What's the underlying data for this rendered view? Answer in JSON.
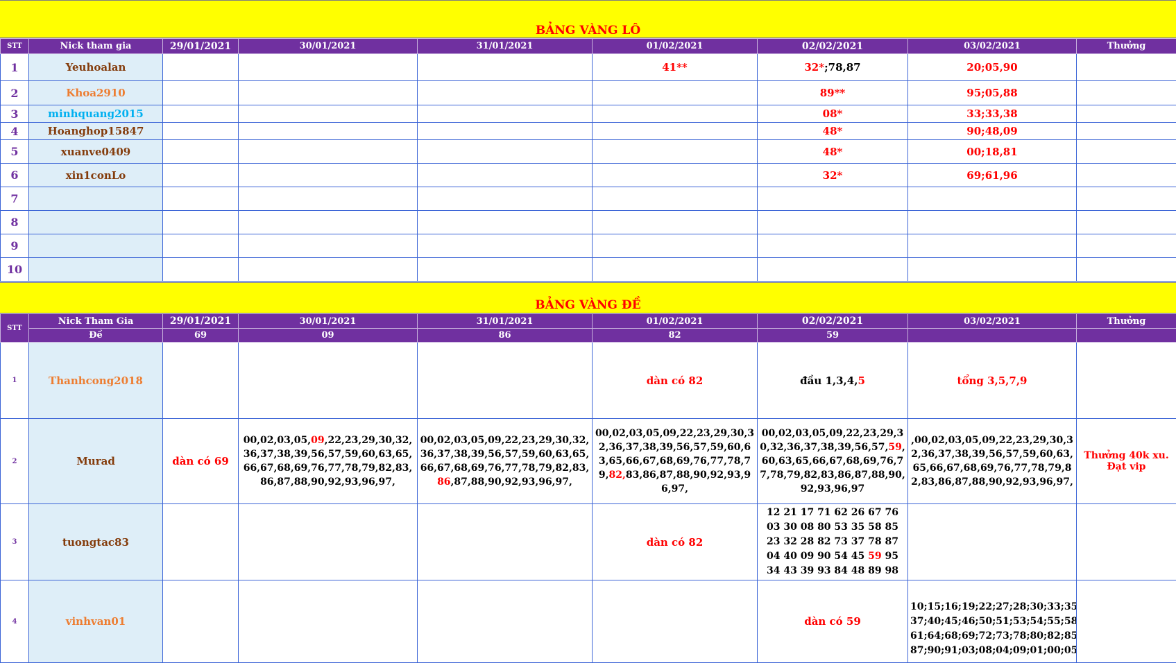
{
  "lo": {
    "title": "BẢNG VÀNG LÔ",
    "headers": {
      "stt": "STT",
      "nick": "Nick tham gia",
      "dates": [
        "29/01/2021",
        "30/01/2021",
        "31/01/2021",
        "01/02/2021",
        "02/02/2021",
        "03/02/2021"
      ],
      "reward": "Thưởng"
    },
    "rows": [
      {
        "stt": "1",
        "nick": "Yeuhoalan",
        "d4": "41**",
        "d5a": "32*",
        "d5b": ";78,87",
        "d6": "20;05,90"
      },
      {
        "stt": "2",
        "nick": "Khoa2910",
        "d5": "89**",
        "d6": "95;05,88"
      },
      {
        "stt": "3",
        "nick": "minhquang2015",
        "d5": "08*",
        "d6": "33;33,38"
      },
      {
        "stt": "4",
        "nick": "Hoanghop15847",
        "d5": "48*",
        "d6": "90;48,09"
      },
      {
        "stt": "5",
        "nick": "xuanve0409",
        "d5": "48*",
        "d6": "00;18,81"
      },
      {
        "stt": "6",
        "nick": "xin1conLo",
        "d5": "32*",
        "d6": "69;61,96"
      },
      {
        "stt": "7"
      },
      {
        "stt": "8"
      },
      {
        "stt": "9"
      },
      {
        "stt": "10"
      }
    ]
  },
  "de": {
    "title": "BẢNG VÀNG ĐỀ",
    "headers": {
      "stt": "STT",
      "nick": "Nick Tham Gia",
      "de_label": "Đề",
      "dates": [
        "29/01/2021",
        "30/01/2021",
        "31/01/2021",
        "01/02/2021",
        "02/02/2021",
        "03/02/2021"
      ],
      "results": [
        "69",
        "09",
        "86",
        "82",
        "59",
        ""
      ],
      "reward": "Thưởng"
    },
    "rows": {
      "r1": {
        "stt": "1",
        "nick": "Thanhcong2018",
        "d4": "dàn có 82",
        "d5a": "đầu 1,3,4,",
        "d5b": "5",
        "d6": "tổng 3,5,7,9"
      },
      "r2": {
        "stt": "2",
        "nick": "Murad",
        "d1": "dàn có 69",
        "d2a": "00,02,03,05,",
        "d2b": "09",
        "d2c": ",22,23,29,30,32,36,37,38,39,56,57,59,60,63,65,66,67,68,69,76,77,78,79,82,83,86,87,88,90,92,93,96,97,",
        "d3a": "00,02,03,05,09,22,23,29,30,32,36,37,38,39,56,57,59,60,63,65,66,67,68,69,76,77,78,79,82,83,",
        "d3b": "86",
        "d3c": ",87,88,90,92,93,96,97,",
        "d4a": "00,02,03,05,09,22,23,29,30,32,36,37,38,39,56,57,59,60,63,65,66,67,68,69,76,77,78,79,",
        "d4b": "82,",
        "d4c": "83,86,87,88,90,92,93,96,97,",
        "d5a": "00,02,03,05,09,22,23,29,30,32,36,37,38,39,56,57,",
        "d5b": "59",
        "d5c": ",60,63,65,66,67,68,69,76,77,78,79,82,83,86,87,88,90,92,93,96,97",
        "d6": ",00,02,03,05,09,22,23,29,30,32,36,37,38,39,56,57,59,60,63,65,66,67,68,69,76,77,78,79,82,83,86,87,88,90,92,93,96,97,",
        "reward": "Thưởng 40k xu. Đạt vip"
      },
      "r3": {
        "stt": "3",
        "nick": "tuongtac83",
        "d4": "dàn có 82",
        "l1": "12 21 17 71 62 26 67 76",
        "l2": "03 30 08 80 53 35 58 85",
        "l3": "23 32 28 82 73 37 78 87",
        "l4a": "04 40 09 90 54 45 ",
        "l4b": "59",
        "l4c": " 95",
        "l5": "34 43 39 93 84 48 89 98"
      },
      "r4": {
        "stt": "4",
        "nick": "vinhvan01",
        "d5": "dàn có 59",
        "l1": "10;15;16;19;22;27;28;30;33;35;",
        "l2": "37;40;45;46;50;51;53;54;55;58;",
        "l3": "61;64;68;69;72;73;78;80;82;85;",
        "l4": "87;90;91;03;08;04;09;01;00;05;"
      }
    }
  },
  "colors": {
    "banner_bg": "#ffff00",
    "header_bg": "#7030a0",
    "nick_bg": "#deeef8",
    "highlight": "#ff0000",
    "border": "#3a63d6"
  }
}
